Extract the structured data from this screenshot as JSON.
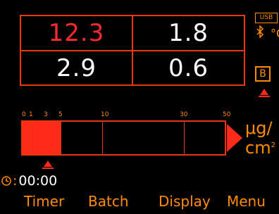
{
  "readings": {
    "top_left": "12.3",
    "top_right": "1.8",
    "bottom_left": "2.9",
    "bottom_right": "0.6"
  },
  "status": {
    "usb": "USB",
    "bluetooth_unit": "°C",
    "mode_letter": "B"
  },
  "bargraph": {
    "ticks": [
      "0",
      "1",
      "3",
      "5",
      "10",
      "30",
      "50"
    ],
    "fill_percent": 19,
    "unit_top": "μg/",
    "unit_bottom": "cm",
    "unit_exp": "2"
  },
  "timer": {
    "value": "00:00"
  },
  "softkeys": {
    "timer": "Timer",
    "batch": "Batch",
    "display": "Display",
    "menu": "Menu"
  },
  "colors": {
    "accent": "#ff8c00",
    "alert": "#ff2a1a",
    "grid": "#e8380d"
  },
  "icons": {
    "bluetooth": "bluetooth-icon",
    "warning": "alarm-triangle-icon",
    "clock": "clock-icon"
  }
}
